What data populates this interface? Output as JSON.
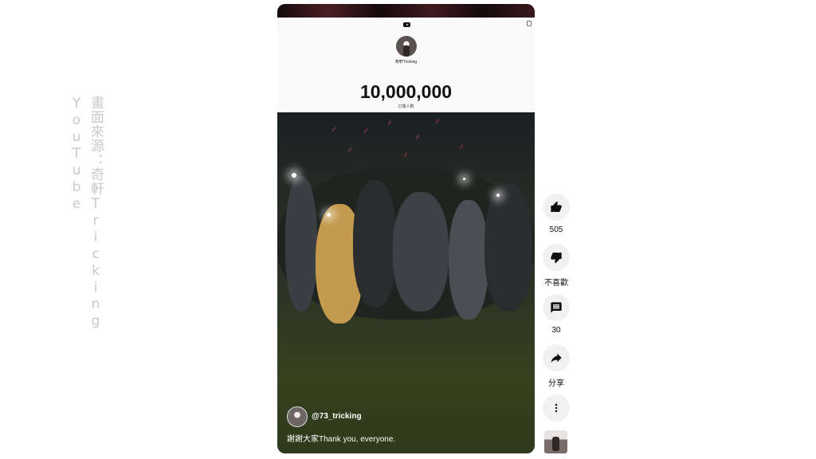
{
  "watermark": "畫面來源：奇軒Tricking YouTube",
  "embedded_screenshot": {
    "channel_name": "奇軒Tricking",
    "subscriber_count": "10,000,000",
    "subscriber_label": "訂閱人數"
  },
  "video": {
    "author_handle": "@73_tricking",
    "caption": "謝謝大家Thank you, everyone."
  },
  "actions": {
    "like_count": "505",
    "dislike_label": "不喜歡",
    "comment_count": "30",
    "share_label": "分享"
  },
  "icons": {
    "like": "thumb-up-icon",
    "dislike": "thumb-down-icon",
    "comment": "comment-icon",
    "share": "share-icon",
    "more": "more-vertical-icon"
  }
}
